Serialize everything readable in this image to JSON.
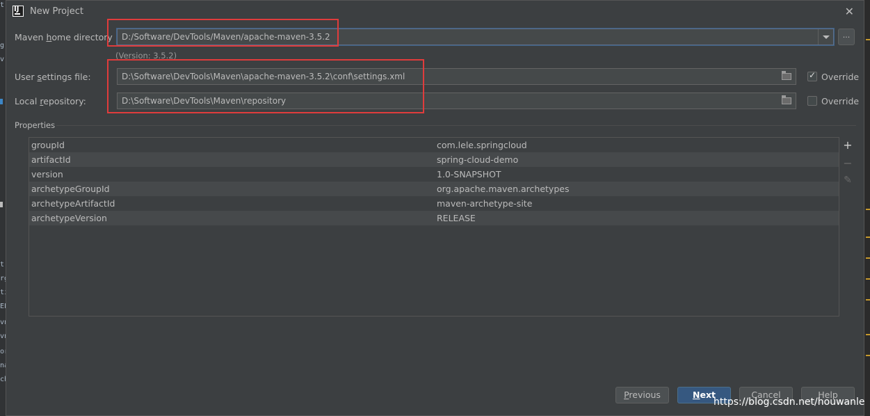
{
  "window": {
    "title": "New Project",
    "close_icon": "close-icon"
  },
  "maven_home": {
    "label_pre": "Maven ",
    "label_mn": "h",
    "label_post": "ome directory",
    "value": "D:/Software/DevTools/Maven/apache-maven-3.5.2",
    "browse_label": "...",
    "version_text": "(Version: 3.5.2)"
  },
  "user_settings": {
    "label_pre": "User ",
    "label_mn": "s",
    "label_post": "ettings file:",
    "value": "D:\\Software\\DevTools\\Maven\\apache-maven-3.5.2\\conf\\settings.xml",
    "override_label": "Override",
    "override_checked": true
  },
  "local_repo": {
    "label_pre": "Local ",
    "label_mn": "r",
    "label_post": "epository:",
    "value": "D:\\Software\\DevTools\\Maven\\repository",
    "override_label": "Override",
    "override_checked": false
  },
  "properties": {
    "section_title": "Properties",
    "rows": [
      {
        "key": "groupId",
        "value": "com.lele.springcloud"
      },
      {
        "key": "artifactId",
        "value": "spring-cloud-demo"
      },
      {
        "key": "version",
        "value": "1.0-SNAPSHOT"
      },
      {
        "key": "archetypeGroupId",
        "value": "org.apache.maven.archetypes"
      },
      {
        "key": "archetypeArtifactId",
        "value": "maven-archetype-site"
      },
      {
        "key": "archetypeVersion",
        "value": "RELEASE"
      }
    ],
    "tools": {
      "add": "+",
      "remove": "−",
      "edit": "✎"
    }
  },
  "buttons": {
    "previous_mn": "P",
    "previous_rest": "revious",
    "next_mn": "N",
    "next_rest": "ext",
    "cancel": "Cancel",
    "help": "Help"
  },
  "watermark": "https://blog.csdn.net/houwanle",
  "colors": {
    "dialog_bg": "#3c3f41",
    "field_bg": "#45494a",
    "primary_button": "#365880",
    "highlight_red": "#e03c3c"
  }
}
